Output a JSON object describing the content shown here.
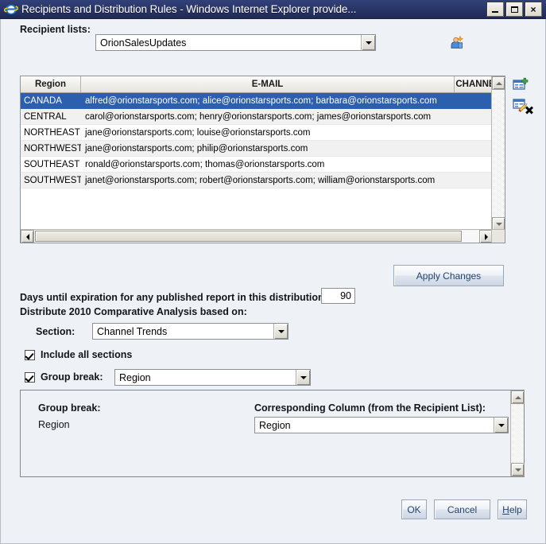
{
  "window": {
    "title": "Recipients and Distribution Rules - Windows Internet Explorer provide...",
    "app_icon": "internet-explorer-icon",
    "minimize_label": "",
    "maximize_label": "",
    "close_label": "×",
    "titlebar_color": "#2a3668"
  },
  "recipient": {
    "label": "Recipient lists:",
    "value": "OrionSalesUpdates",
    "new_list_icon": "new-recipient-list-icon",
    "delete_list_icon": "delete-list-x-icon"
  },
  "grid": {
    "columns": [
      "Region",
      "E-MAIL",
      "CHANNEL"
    ],
    "rows": [
      {
        "region": "CANADA",
        "email": "alfred@orionstarsports.com; alice@orionstarsports.com; barbara@orionstarsports.com",
        "channel": "",
        "selected": true
      },
      {
        "region": "CENTRAL",
        "email": "carol@orionstarsports.com; henry@orionstarsports.com; james@orionstarsports.com",
        "channel": "",
        "selected": false
      },
      {
        "region": "NORTHEAST",
        "email": "jane@orionstarsports.com; louise@orionstarsports.com",
        "channel": "",
        "selected": false
      },
      {
        "region": "NORTHWEST",
        "email": "jane@orionstarsports.com; philip@orionstarsports.com",
        "channel": "",
        "selected": false
      },
      {
        "region": "SOUTHEAST",
        "email": "ronald@orionstarsports.com; thomas@orionstarsports.com",
        "channel": "",
        "selected": false
      },
      {
        "region": "SOUTHWEST",
        "email": "janet@orionstarsports.com; robert@orionstarsports.com; william@orionstarsports.com",
        "channel": "",
        "selected": false
      }
    ],
    "selection_color": "#2c5fad"
  },
  "side_tools": [
    {
      "name": "add-record-icon",
      "label": ""
    },
    {
      "name": "edit-record-icon",
      "label": ""
    },
    {
      "name": "delete-record-icon",
      "label": ""
    }
  ],
  "apply": {
    "label": "Apply Changes"
  },
  "expiration": {
    "label": "Days until expiration for any published report in this distribution:",
    "value": "90"
  },
  "distribute": {
    "label": "Distribute 2010 Comparative Analysis based on:",
    "section_label": "Section:",
    "section_value": "Channel Trends"
  },
  "options": {
    "include_all_sections_label": "Include all sections",
    "include_all_sections_checked": true,
    "group_break_label": "Group break:",
    "group_break_checked": true,
    "group_break_value": "Region"
  },
  "group_break_panel": {
    "title": "Group break:",
    "value": "Region",
    "column_title": "Corresponding Column (from the Recipient List):",
    "column_value": "Region"
  },
  "footer": {
    "ok": "OK",
    "cancel": "Cancel",
    "help_prefix": "H",
    "help_rest": "elp"
  }
}
